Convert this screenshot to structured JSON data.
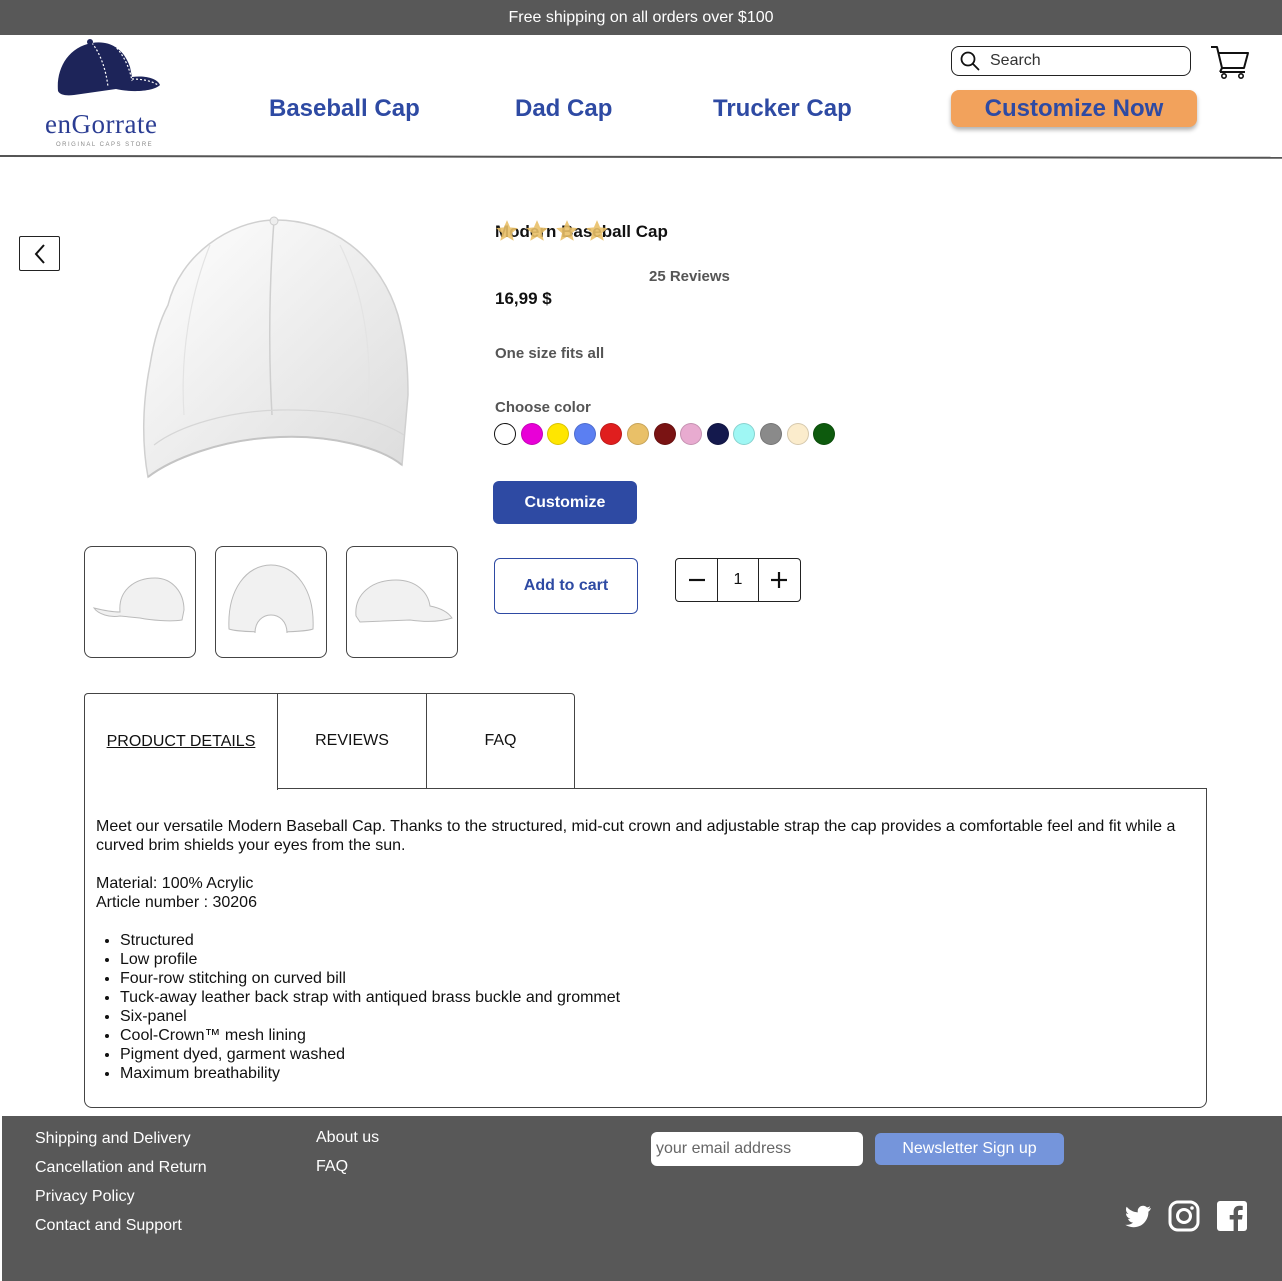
{
  "promo": {
    "text": "Free shipping on all orders over $100"
  },
  "brand": {
    "name": "enGorrate",
    "tagline": "ORIGINAL CAPS STORE",
    "logo_color": "#1d2459"
  },
  "nav": {
    "items": [
      {
        "label": "Baseball Cap"
      },
      {
        "label": "Dad Cap"
      },
      {
        "label": "Trucker Cap"
      }
    ],
    "customize_now": "Customize Now"
  },
  "search": {
    "placeholder": "Search",
    "value": ""
  },
  "product": {
    "title": "Modern Baseball Cap",
    "rating": 4,
    "rating_max": 5,
    "reviews_count": "25 Reviews",
    "price": "16,99 $",
    "size_note": "One size fits all",
    "choose_color_label": "Choose color",
    "colors": [
      "#ffffff",
      "#e800d7",
      "#ffe600",
      "#5b7ff2",
      "#e01e1e",
      "#e9c068",
      "#7a1313",
      "#e8abd0",
      "#14194d",
      "#9ff7f4",
      "#8a8a8a",
      "#fbeccc",
      "#0d5a0d"
    ],
    "customize_label": "Customize",
    "add_to_cart_label": "Add to cart",
    "quantity": "1"
  },
  "tabs": {
    "items": [
      {
        "label": "PRODUCT DETAILS"
      },
      {
        "label": "REVIEWS"
      },
      {
        "label": "FAQ"
      }
    ],
    "active": 0
  },
  "details": {
    "description": "Meet our versatile Modern Baseball Cap. Thanks to the structured, mid-cut crown and adjustable strap the cap provides a comfortable feel and fit while a curved brim shields your eyes from the sun.",
    "material": "Material: 100% Acrylic",
    "article": "Article number : 30206",
    "features": [
      "Structured",
      "Low profile",
      "Four-row stitching on curved bill",
      "Tuck-away leather back strap with antiqued brass buckle and grommet",
      "Six-panel",
      "Cool-Crown™ mesh lining",
      "Pigment dyed, garment washed",
      "Maximum breathability"
    ]
  },
  "footer": {
    "col1": [
      "Shipping and Delivery",
      "Cancellation and Return",
      "Privacy Policy",
      "Contact and Support"
    ],
    "col2": [
      "About us",
      "FAQ"
    ],
    "email_placeholder": "your email address",
    "newsletter_label": "Newsletter Sign up"
  },
  "colors": {
    "accent": "#2e4aa3",
    "cta": "#f2a25c",
    "star": "#e9c068",
    "footer_bg": "#585858"
  }
}
